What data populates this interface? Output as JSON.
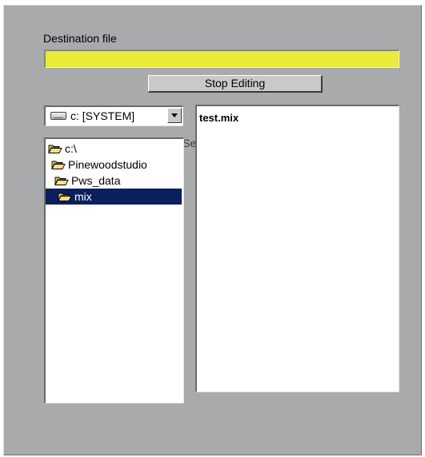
{
  "destination": {
    "label": "Destination file",
    "value": "",
    "field_color": "#eaea3a"
  },
  "stop_button": {
    "label": "Stop Editing"
  },
  "drive": {
    "selected": "c: [SYSTEM]",
    "icon": "drive-icon"
  },
  "directories": [
    {
      "name": "c:\\",
      "icon": "folder-open-icon",
      "selected": false
    },
    {
      "name": "Pinewoodstudio",
      "icon": "folder-open-icon",
      "selected": false
    },
    {
      "name": "Pws_data",
      "icon": "folder-open-icon",
      "selected": false
    },
    {
      "name": "mix",
      "icon": "folder-open-icon",
      "selected": true
    }
  ],
  "partial_label": "Se",
  "files": [
    {
      "name": "test.mix"
    }
  ],
  "colors": {
    "panel": "#a9aaac",
    "selection": "#0a1f5c"
  }
}
